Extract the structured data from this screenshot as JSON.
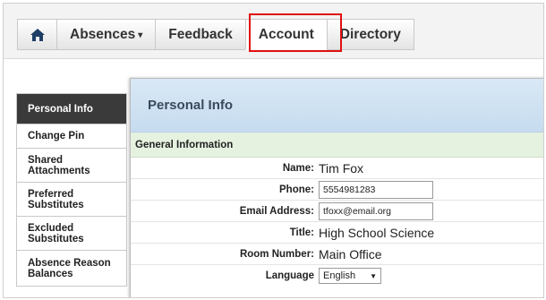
{
  "nav": {
    "home_icon": "home-icon",
    "tabs": [
      {
        "label": "Absences",
        "has_dropdown": true
      },
      {
        "label": "Feedback"
      },
      {
        "label": "Account",
        "active": true,
        "highlighted": true
      },
      {
        "label": "Directory"
      }
    ],
    "caret": "▾"
  },
  "sidebar": {
    "items": [
      {
        "label": "Personal Info",
        "active": true
      },
      {
        "label": "Change Pin"
      },
      {
        "label": "Shared Attachments"
      },
      {
        "label": "Preferred Substitutes"
      },
      {
        "label": "Excluded Substitutes"
      },
      {
        "label": "Absence Reason Balances"
      }
    ]
  },
  "panel": {
    "title": "Personal Info",
    "section": "General Information",
    "fields": {
      "name": {
        "label": "Name:",
        "value": "Tim Fox"
      },
      "phone": {
        "label": "Phone:",
        "value": "5554981283"
      },
      "email": {
        "label": "Email Address:",
        "value": "tfoxx@email.org"
      },
      "title": {
        "label": "Title:",
        "value": "High School Science"
      },
      "room": {
        "label": "Room Number:",
        "value": "Main Office"
      },
      "language": {
        "label": "Language",
        "value": "English"
      }
    }
  },
  "colors": {
    "highlight": "#e01010",
    "sidebar_active": "#3a3a3a",
    "panel_header": "#c6dcef",
    "section_header": "#e6f2e0"
  }
}
